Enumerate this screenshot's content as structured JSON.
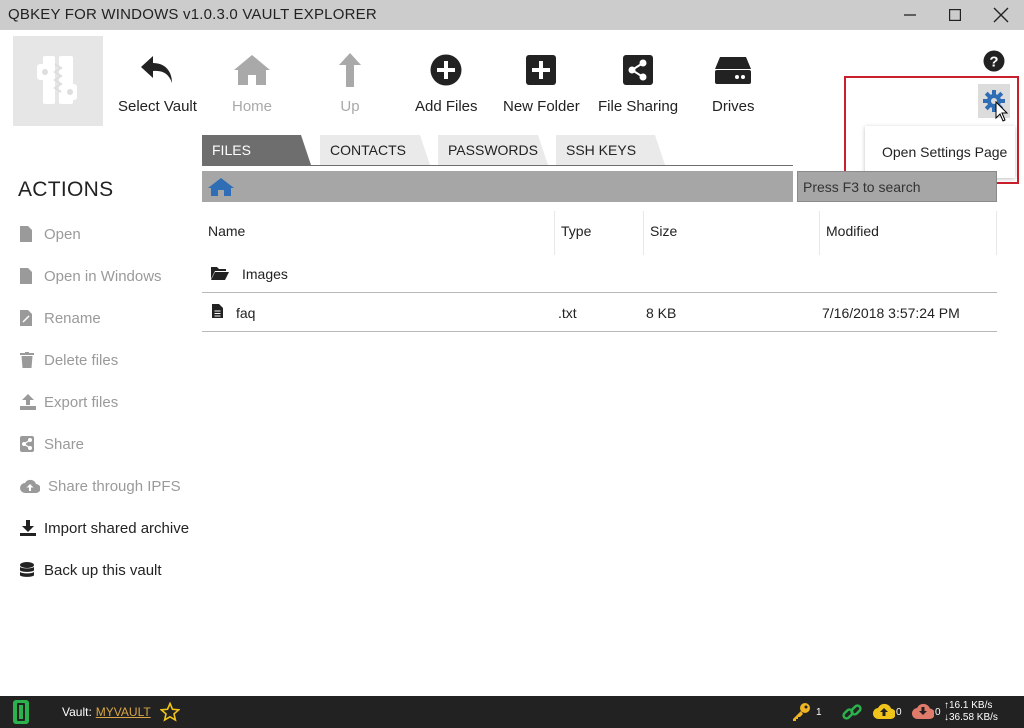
{
  "window": {
    "title": "QBKEY FOR WINDOWS v1.0.3.0  VAULT EXPLORER"
  },
  "toolbar": {
    "select_vault": "Select Vault",
    "home": "Home",
    "up": "Up",
    "add_files": "Add Files",
    "new_folder": "New Folder",
    "file_sharing": "File Sharing",
    "drives": "Drives"
  },
  "settings_menu": {
    "open_settings": "Open Settings Page"
  },
  "tabs": [
    {
      "label": "FILES",
      "active": true
    },
    {
      "label": "CONTACTS",
      "active": false
    },
    {
      "label": "PASSWORDS",
      "active": false
    },
    {
      "label": "SSH KEYS",
      "active": false
    }
  ],
  "search": {
    "placeholder": "Press F3 to search"
  },
  "actions": {
    "title": "ACTIONS",
    "items": [
      {
        "label": "Open",
        "icon": "file-icon",
        "enabled": false
      },
      {
        "label": "Open in Windows",
        "icon": "file-icon",
        "enabled": false
      },
      {
        "label": "Rename",
        "icon": "file-edit-icon",
        "enabled": false
      },
      {
        "label": "Delete files",
        "icon": "trash-icon",
        "enabled": false
      },
      {
        "label": "Export files",
        "icon": "upload-icon",
        "enabled": false
      },
      {
        "label": "Share",
        "icon": "share-icon",
        "enabled": false
      },
      {
        "label": "Share through IPFS",
        "icon": "cloud-upload-icon",
        "enabled": false
      },
      {
        "label": "Import shared archive",
        "icon": "download-icon",
        "enabled": true
      },
      {
        "label": "Back up this vault",
        "icon": "database-icon",
        "enabled": true
      }
    ]
  },
  "files_table": {
    "columns": [
      "Name",
      "Type",
      "Size",
      "Modified"
    ],
    "rows": [
      {
        "name": "Images",
        "type": "",
        "size": "",
        "modified": "",
        "icon": "folder-open-icon"
      },
      {
        "name": "faq",
        "type": ".txt",
        "size": "8 KB",
        "modified": "7/16/2018 3:57:24 PM",
        "icon": "file-text-icon"
      }
    ]
  },
  "statusbar": {
    "vault_label": "Vault:",
    "vault_name": "MYVAULT",
    "keys_count": "1",
    "uploads_count": "0",
    "downloads_count": "0",
    "upload_rate": "16.1 KB/s",
    "download_rate": "36.58 KB/s"
  },
  "colors": {
    "titlebar": "#cccccc",
    "active_tab": "#6e6e6e",
    "pathbar": "#a6a6a6",
    "highlight_border": "#c8202a",
    "gear_blue": "#2f6db5",
    "statusbar": "#222222",
    "vault_link": "#d8a646"
  }
}
